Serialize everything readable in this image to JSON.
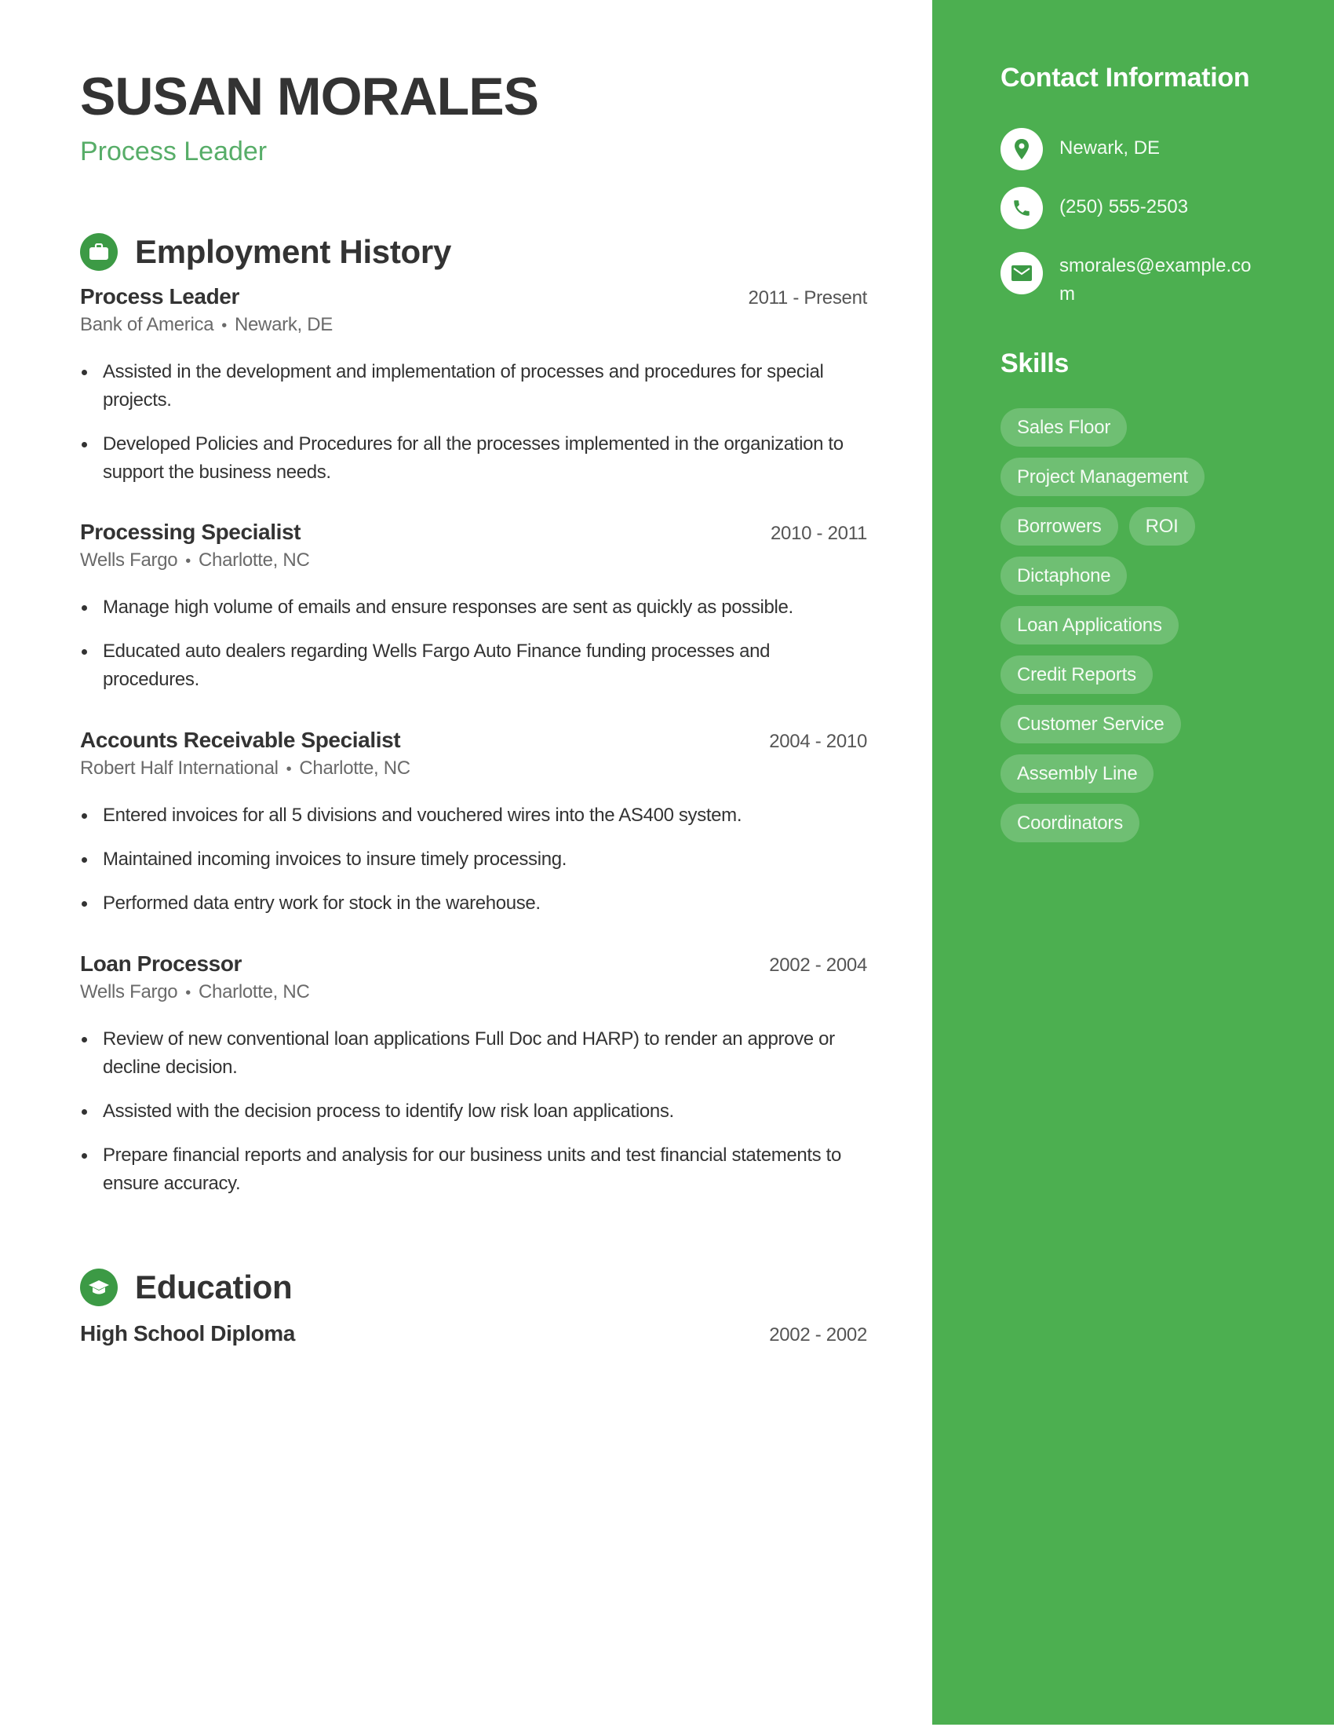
{
  "header": {
    "name": "SUSAN MORALES",
    "title": "Process Leader"
  },
  "employment": {
    "heading": "Employment History",
    "icon": "briefcase-icon",
    "jobs": [
      {
        "title": "Process Leader",
        "dates": "2011 - Present",
        "company": "Bank of America",
        "location": "Newark, DE",
        "bullets": [
          "Assisted in the development and implementation of processes and procedures for special projects.",
          "Developed Policies and Procedures for all the processes implemented in the organization to support the business needs."
        ]
      },
      {
        "title": "Processing Specialist",
        "dates": "2010 - 2011",
        "company": "Wells Fargo",
        "location": "Charlotte, NC",
        "bullets": [
          "Manage high volume of emails and ensure responses are sent as quickly as possible.",
          "Educated auto dealers regarding Wells Fargo Auto Finance funding processes and procedures."
        ]
      },
      {
        "title": "Accounts Receivable Specialist",
        "dates": "2004 - 2010",
        "company": "Robert Half International",
        "location": "Charlotte, NC",
        "bullets": [
          "Entered invoices for all 5 divisions and vouchered wires into the AS400 system.",
          "Maintained incoming invoices to insure timely processing.",
          "Performed data entry work for stock in the warehouse."
        ]
      },
      {
        "title": "Loan Processor",
        "dates": "2002 - 2004",
        "company": "Wells Fargo",
        "location": "Charlotte, NC",
        "bullets": [
          "Review of new conventional loan applications Full Doc and HARP) to render an approve or decline decision.",
          "Assisted with the decision process to identify low risk loan applications.",
          "Prepare financial reports and analysis for our business units and test financial statements to ensure accuracy."
        ]
      }
    ]
  },
  "education": {
    "heading": "Education",
    "icon": "graduation-cap-icon",
    "items": [
      {
        "degree": "High School Diploma",
        "dates": "2002 - 2002"
      }
    ]
  },
  "sidebar": {
    "contact_heading": "Contact Information",
    "contact": [
      {
        "icon": "location-pin-icon",
        "text": "Newark, DE"
      },
      {
        "icon": "phone-icon",
        "text": "(250) 555-2503"
      },
      {
        "icon": "mail-icon",
        "text": "smorales@example.com"
      }
    ],
    "skills_heading": "Skills",
    "skills": [
      "Sales Floor",
      "Project Management",
      "Borrowers",
      "ROI",
      "Dictaphone",
      "Loan Applications",
      "Credit Reports",
      "Customer Service",
      "Assembly Line",
      "Coordinators"
    ]
  },
  "colors": {
    "accent": "#4caf50",
    "accent_dark": "#3c9a45",
    "subtitle_green": "#57ad68",
    "text": "#333333",
    "muted": "#6a6a6a"
  }
}
